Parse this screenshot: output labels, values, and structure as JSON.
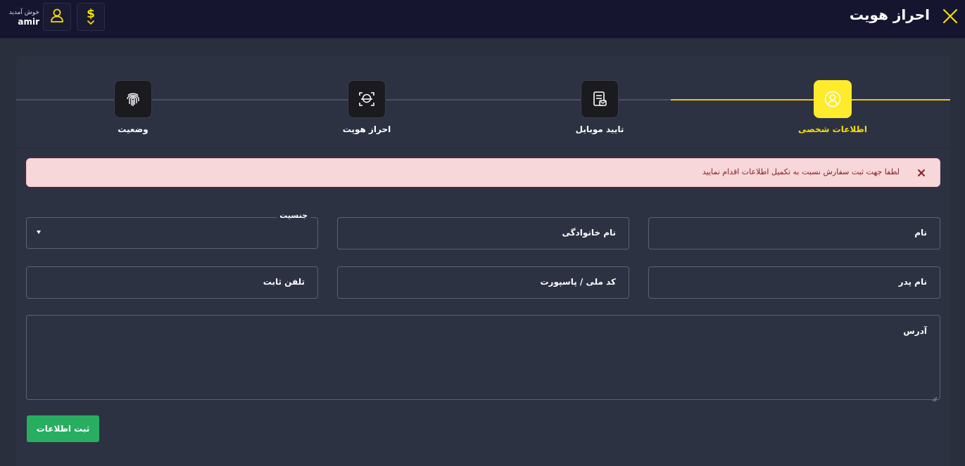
{
  "header": {
    "title": "احراز هویت",
    "welcome_text": "خوش آمدید",
    "username": "amir",
    "close_icon": "close-icon",
    "profile_icon": "user-icon",
    "wallet_icon": "dollar-icon",
    "accent_color": "#f5dd00"
  },
  "stepper": {
    "active_index": 0,
    "steps": [
      {
        "label": "اطلاعات شخصی",
        "icon": "user-circle-icon"
      },
      {
        "label": "تایید موبایل",
        "icon": "mobile-verify-icon"
      },
      {
        "label": "احراز هویت",
        "icon": "face-scan-icon"
      },
      {
        "label": "وضعیت",
        "icon": "fingerprint-icon"
      }
    ]
  },
  "alert": {
    "message": "لطفا جهت ثبت سفارش نسبت به تکمیل اطلاعات اقدام نمایید",
    "background": "#f8d7da",
    "text_color": "#842029"
  },
  "form": {
    "first_name": {
      "label": "نام",
      "value": ""
    },
    "last_name": {
      "label": "نام خانوادگی",
      "value": ""
    },
    "gender": {
      "label": "جنسیت",
      "value": ""
    },
    "father_name": {
      "label": "نام پدر",
      "value": ""
    },
    "national_code": {
      "label": "کد ملی / پاسپورت",
      "value": ""
    },
    "landline": {
      "label": "تلفن ثابت",
      "value": ""
    },
    "address": {
      "label": "آدرس",
      "value": ""
    },
    "submit_label": "ثبت اطلاعات",
    "submit_color": "#27ae60"
  }
}
